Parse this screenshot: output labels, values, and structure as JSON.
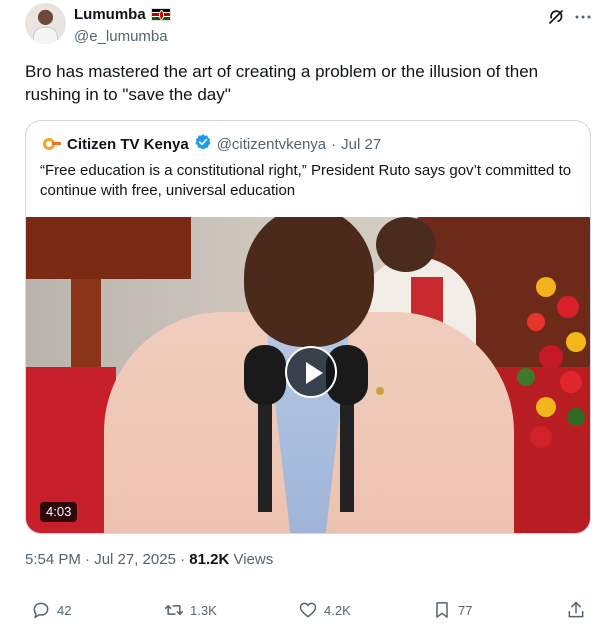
{
  "author": {
    "name": "Lumumba",
    "handle": "@e_lumumba",
    "flag_icon": "kenya-flag-icon"
  },
  "tweet": {
    "text": "Bro has mastered the art of creating a problem or the illusion of then rushing in to \"save the day\""
  },
  "quoted": {
    "name": "Citizen TV Kenya",
    "verified": "verified-badge-icon",
    "handle": "@citizentvkenya",
    "separator": "·",
    "date": "Jul 27",
    "text": "“Free education is a constitutional right,” President Ruto says gov’t committed to continue with free, universal education",
    "video": {
      "duration": "4:03"
    }
  },
  "meta": {
    "timestamp": "5:54 PM · Jul 27, 2025",
    "separator": "·",
    "views_count": "81.2K",
    "views_label": "Views"
  },
  "actions": {
    "replies": "42",
    "reposts": "1.3K",
    "likes": "4.2K",
    "bookmarks": "77"
  },
  "colors": {
    "text": "#0f1419",
    "secondary": "#536471",
    "border": "#cfd9de",
    "verified": "#1d9bf0"
  }
}
